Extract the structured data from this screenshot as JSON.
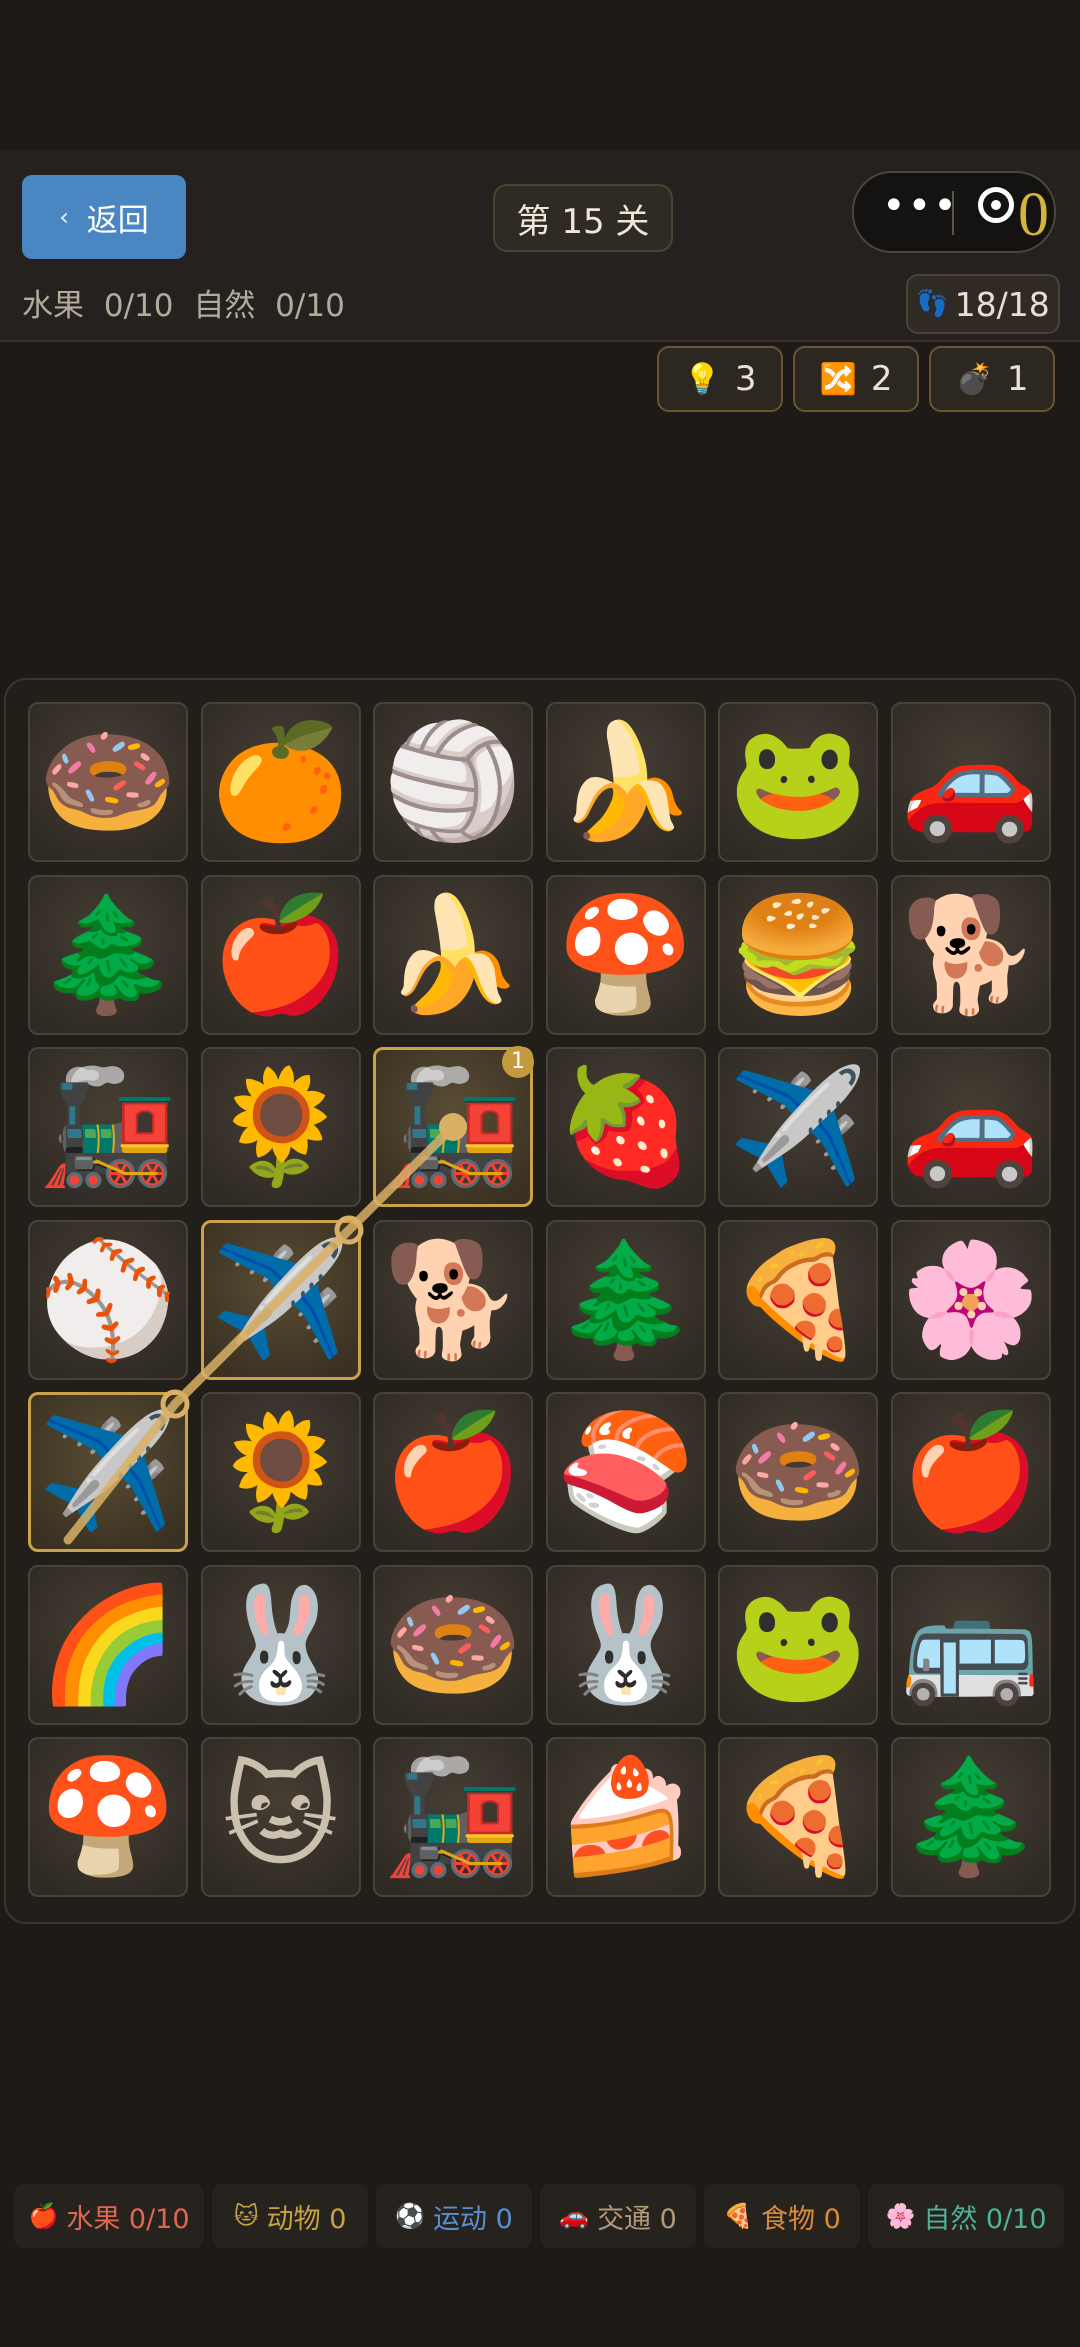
{
  "header": {
    "back_label": "返回",
    "level": "第 15 关",
    "score": "0",
    "progress": "水果 0/10  自然 0/10",
    "moves": "18/18"
  },
  "tools": [
    {
      "icon": "💡",
      "count": "3",
      "name": "hint"
    },
    {
      "icon": "🔀",
      "count": "2",
      "name": "shuffle"
    },
    {
      "icon": "💣",
      "count": "1",
      "name": "bomb"
    }
  ],
  "board": {
    "rows": [
      [
        "🍩",
        "🍊",
        "🏐",
        "🍌",
        "🐸",
        "🚗"
      ],
      [
        "🌲",
        "🍎",
        "🍌",
        "🍄",
        "🍔",
        "🐕"
      ],
      [
        "🚂",
        "🌻",
        "🚂",
        "🍓",
        "✈️",
        "🚗"
      ],
      [
        "⚾",
        "✈️",
        "🐕",
        "🌲",
        "🍕",
        "🌸"
      ],
      [
        "✈️",
        "🌻",
        "🍎",
        "🍣",
        "🍩",
        "🍎"
      ],
      [
        "🌈",
        "🐰",
        "🍩",
        "🐰",
        "🐸",
        "🚌"
      ],
      [
        "🍄",
        "🐱",
        "🚂",
        "🍰",
        "🍕",
        "🌲"
      ]
    ],
    "selected_badge": "1"
  },
  "categories": [
    {
      "icon": "🍎",
      "label": "水果 0/10",
      "color": "#e0674f"
    },
    {
      "icon": "🐱",
      "label": "动物 0",
      "color": "#c9a240"
    },
    {
      "icon": "⚽",
      "label": "运动 0",
      "color": "#5b8fd4"
    },
    {
      "icon": "🚗",
      "label": "交通 0",
      "color": "#b09a78"
    },
    {
      "icon": "🍕",
      "label": "食物 0",
      "color": "#d98a3a"
    },
    {
      "icon": "🌸",
      "label": "自然 0/10",
      "color": "#4fb39a"
    }
  ]
}
